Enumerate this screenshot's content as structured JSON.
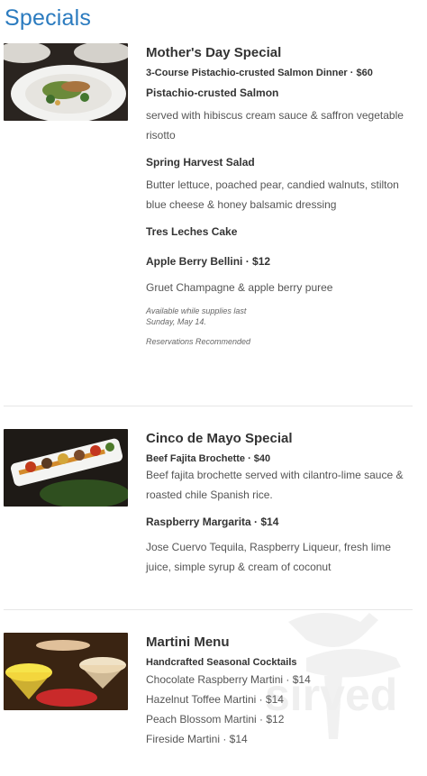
{
  "page": {
    "title": "Specials"
  },
  "specials": [
    {
      "image_alt": "plated salmon dish",
      "title": "Mother's Day Special",
      "subtitle": "3-Course Pistachio-crusted Salmon Dinner · $60",
      "items": [
        {
          "name": "Pistachio-crusted Salmon",
          "desc": "served with hibiscus cream sauce & saffron vegetable risotto"
        },
        {
          "name": "Spring Harvest Salad",
          "desc": "Butter lettuce, poached pear, candied walnuts, stilton blue cheese & honey balsamic dressing"
        },
        {
          "name": "Tres Leches Cake",
          "desc": ""
        },
        {
          "name": "Apple Berry Bellini · $12",
          "desc": "Gruet Champagne & apple berry puree"
        }
      ],
      "notes": [
        "Available while supplies last",
        "Sunday, May 14.",
        "Reservations Recommended"
      ]
    },
    {
      "image_alt": "fajita brochette skewer",
      "title": "Cinco de Mayo Special",
      "subtitle": "Beef Fajita Brochette · $40",
      "subtitle_desc": "Beef fajita brochette served with cilantro-lime sauce & roasted chile Spanish rice.",
      "items": [
        {
          "name": "Raspberry Margarita · $14",
          "desc": "Jose Cuervo Tequila, Raspberry Liqueur, fresh lime juice, simple syrup & cream of coconut"
        }
      ]
    },
    {
      "image_alt": "martini cocktails",
      "title": "Martini Menu",
      "subtitle": "Handcrafted Seasonal Cocktails",
      "lines": [
        "Chocolate Raspberry Martini · $14",
        "Hazelnut Toffee Martini · $14",
        "Peach Blossom Martini · $12",
        "Fireside Martini · $14"
      ]
    }
  ],
  "watermark": {
    "text": "sirved"
  }
}
